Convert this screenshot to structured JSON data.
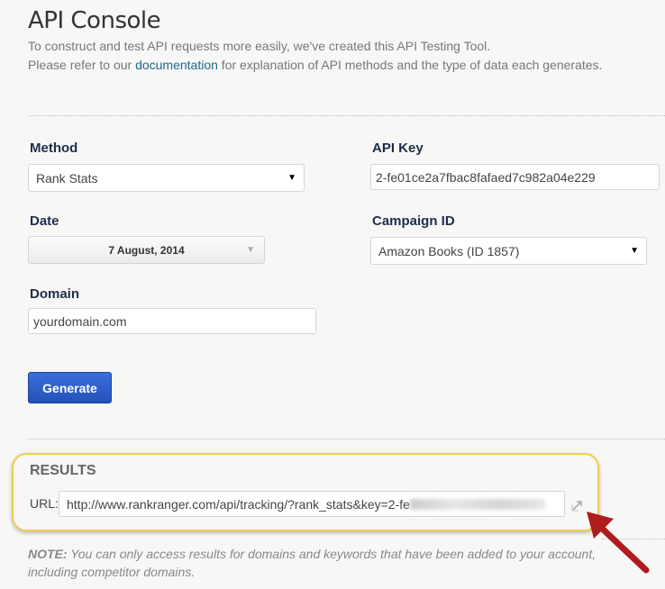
{
  "header": {
    "title": "API Console",
    "line1": "To construct and test API requests more easily, we've created this API Testing Tool.",
    "line2_pre": "Please refer to our ",
    "line2_link": "documentation",
    "line2_post": " for explanation of API methods and the type of data each generates."
  },
  "form": {
    "method": {
      "label": "Method",
      "value": "Rank Stats"
    },
    "api_key": {
      "label": "API Key",
      "value": "2-fe01ce2a7fbac8fafaed7c982a04e229"
    },
    "date": {
      "label": "Date",
      "value": "7 August, 2014"
    },
    "campaign": {
      "label": "Campaign ID",
      "value": "Amazon Books (ID 1857)"
    },
    "domain": {
      "label": "Domain",
      "value": "yourdomain.com"
    },
    "generate_label": "Generate"
  },
  "results": {
    "heading": "RESULTS",
    "url_label": "URL:",
    "url_value": "http://www.rankranger.com/api/tracking/?rank_stats&key=2-fe"
  },
  "note": {
    "bold": "NOTE:",
    "line1": " You can only access results for domains and keywords that have been added to your account,",
    "line2": "including competitor domains."
  },
  "colors": {
    "accent": "#2a5fc9",
    "highlight": "#f1cc4a",
    "arrow": "#b01c1c"
  }
}
